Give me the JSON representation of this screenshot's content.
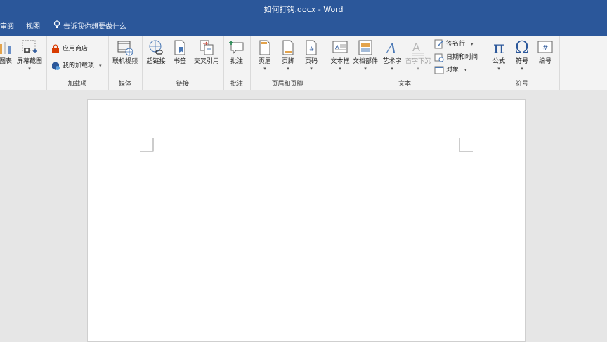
{
  "window": {
    "title": "如何打钩.docx - Word"
  },
  "tabs": {
    "review": "审阅",
    "view": "视图",
    "tell_me": "告诉我你想要做什么"
  },
  "ribbon": {
    "illustrations": {
      "chart": "图表",
      "screenshot": "屏幕截图"
    },
    "addins": {
      "store": "应用商店",
      "my_addins": "我的加载项",
      "label": "加载项"
    },
    "media": {
      "online_video": "联机视频",
      "label": "媒体"
    },
    "links": {
      "hyperlink": "超链接",
      "bookmark": "书签",
      "cross_ref": "交叉引用",
      "label": "链接"
    },
    "comments": {
      "comment": "批注",
      "label": "批注"
    },
    "header_footer": {
      "header": "页眉",
      "footer": "页脚",
      "page_number": "页码",
      "label": "页眉和页脚"
    },
    "text": {
      "textbox": "文本框",
      "quick_parts": "文档部件",
      "wordart": "艺术字",
      "dropcap": "首字下沉",
      "signature": "签名行",
      "datetime": "日期和时间",
      "object": "对象",
      "label": "文本"
    },
    "symbols": {
      "equation": "公式",
      "symbol": "符号",
      "number": "编号",
      "label": "符号"
    }
  },
  "colors": {
    "brand": "#2b579a",
    "ribbon_bg": "#f3f3f3",
    "canvas_bg": "#e6e6e6"
  }
}
